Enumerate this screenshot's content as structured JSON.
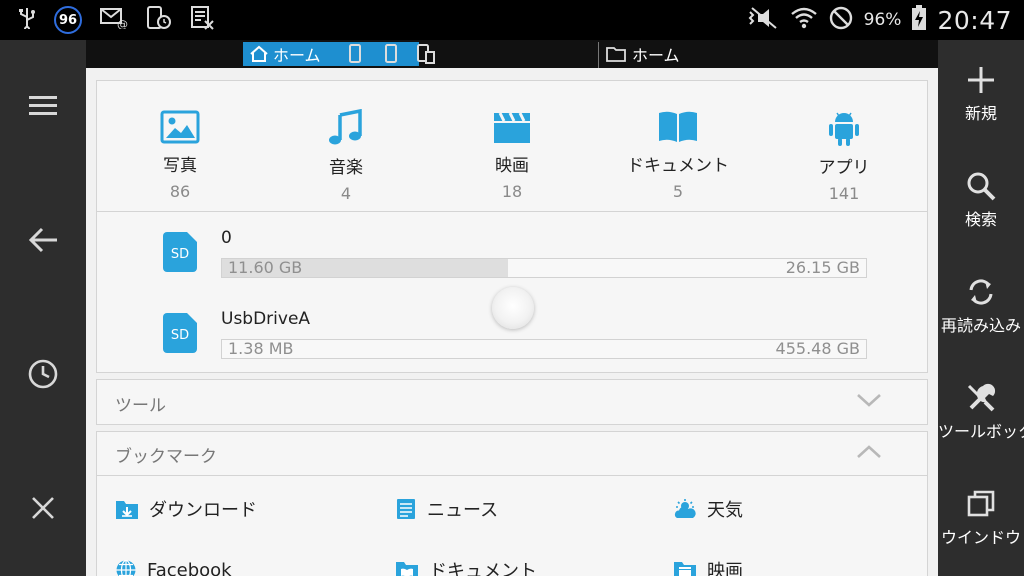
{
  "status_bar": {
    "badge": "96",
    "battery_pct": "96%",
    "time": "20:47"
  },
  "tabs": {
    "active_label": "ホーム",
    "path_label": "ホーム"
  },
  "categories": [
    {
      "label": "写真",
      "count": "86",
      "icon": "image-icon"
    },
    {
      "label": "音楽",
      "count": "4",
      "icon": "music-icon"
    },
    {
      "label": "映画",
      "count": "18",
      "icon": "clapperboard-icon"
    },
    {
      "label": "ドキュメント",
      "count": "5",
      "icon": "book-icon"
    },
    {
      "label": "アプリ",
      "count": "141",
      "icon": "android-icon"
    }
  ],
  "storage": [
    {
      "badge": "SD",
      "name": "0",
      "used": "11.60 GB",
      "total": "26.15 GB",
      "fraction": 0.444
    },
    {
      "badge": "SD",
      "name": "UsbDriveA",
      "used": "1.38 MB",
      "total": "455.48 GB",
      "fraction": 0.0
    }
  ],
  "tools_section": {
    "title": "ツール"
  },
  "bookmarks_section": {
    "title": "ブックマーク",
    "items": [
      {
        "label": "ダウンロード",
        "icon": "download-folder-icon"
      },
      {
        "label": "ニュース",
        "icon": "news-icon"
      },
      {
        "label": "天気",
        "icon": "weather-icon"
      },
      {
        "label": "Facebook",
        "icon": "globe-icon"
      },
      {
        "label": "ドキュメント",
        "icon": "book-folder-icon"
      },
      {
        "label": "映画",
        "icon": "clapperboard-folder-icon"
      }
    ]
  },
  "right_rail": [
    {
      "label": "新規",
      "icon": "plus-icon"
    },
    {
      "label": "検索",
      "icon": "search-icon"
    },
    {
      "label": "再読み込み",
      "icon": "refresh-icon"
    },
    {
      "label": "ツールボックス",
      "icon": "tools-icon"
    },
    {
      "label": "ウインドウ",
      "icon": "windows-icon"
    }
  ],
  "colors": {
    "accent": "#1e8fd0",
    "icon_blue": "#2aa3dc"
  }
}
